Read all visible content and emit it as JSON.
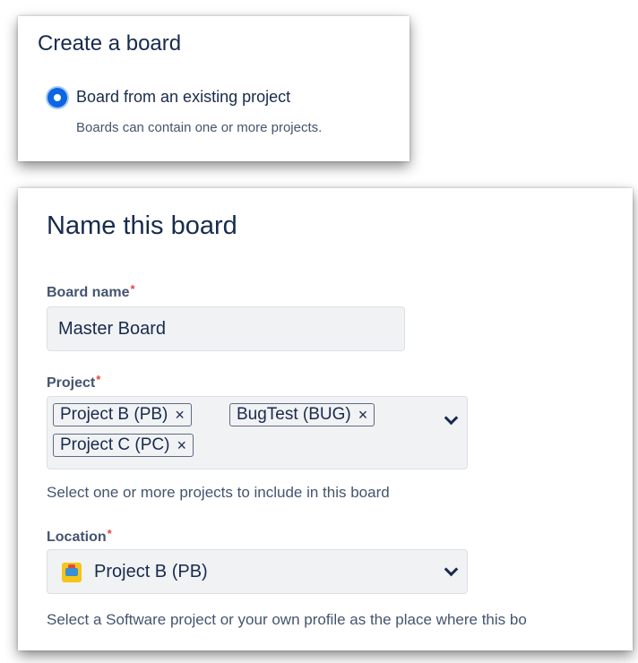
{
  "create_board": {
    "title": "Create a board",
    "option_label": "Board from an existing project",
    "option_help": "Boards can contain one or more projects."
  },
  "name_board": {
    "title": "Name this board",
    "board_name": {
      "label": "Board name",
      "required_mark": "*",
      "value": "Master Board"
    },
    "project": {
      "label": "Project",
      "required_mark": "*",
      "tags": [
        {
          "label": "Project B (PB)",
          "remove": "×"
        },
        {
          "label": "BugTest (BUG)",
          "remove": "×"
        },
        {
          "label": "Project C (PC)",
          "remove": "×"
        }
      ],
      "help": "Select one or more projects to include in this board"
    },
    "location": {
      "label": "Location",
      "required_mark": "*",
      "value": "Project B (PB)",
      "help": "Select a Software project or your own profile as the place where this bo"
    }
  },
  "colors": {
    "accent": "#0c66e4",
    "required": "#e2483d",
    "field_bg": "#f1f2f4"
  }
}
